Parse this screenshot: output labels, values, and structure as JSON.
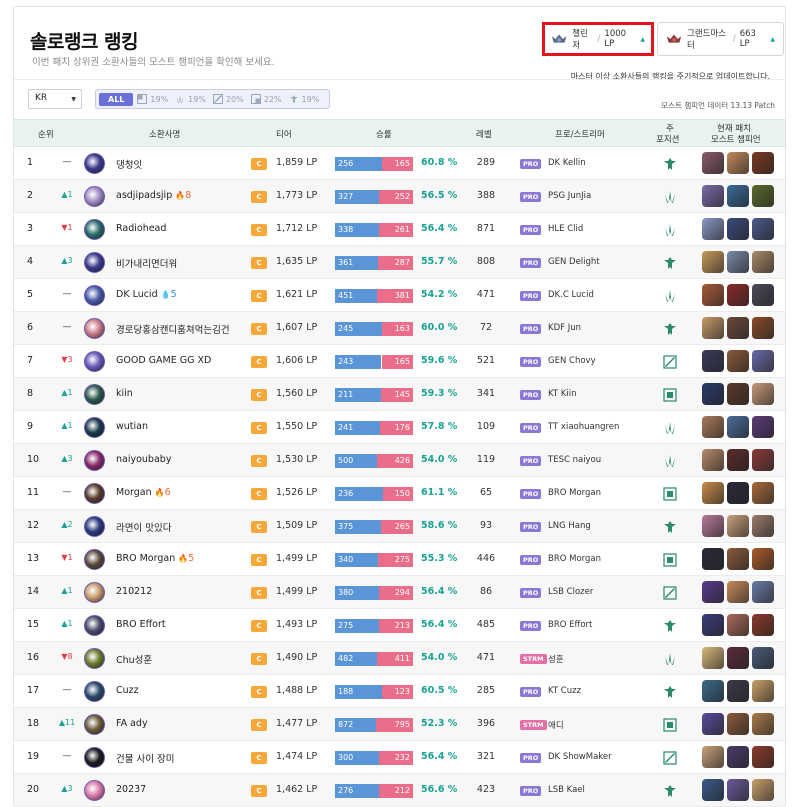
{
  "header": {
    "title": "솔로랭크 랭킹",
    "subtitle": "이번 패치 상위권 소환사들의 모스트 챔피언을 확인해 보세요.",
    "challenger": {
      "label": "챌린저",
      "lp": "1000 LP"
    },
    "grandmaster": {
      "label": "그랜드마스터",
      "lp": "663 LP"
    },
    "sep": "/",
    "update_note": "마스터 이상 소환사들의 랭킹을 주기적으로 업데이트합니다."
  },
  "filters": {
    "region": "KR",
    "all_label": "ALL",
    "positions": [
      {
        "icon": "top-lane-icon",
        "pct": "19%"
      },
      {
        "icon": "jungle-icon",
        "pct": "19%"
      },
      {
        "icon": "mid-lane-icon",
        "pct": "20%"
      },
      {
        "icon": "bot-lane-icon",
        "pct": "22%"
      },
      {
        "icon": "support-icon",
        "pct": "19%"
      }
    ],
    "patch_note": "모스트 챔피언 데이터 13.13 Patch"
  },
  "columns": {
    "rank": "순위",
    "name": "소환사명",
    "tier": "티어",
    "winrate": "승률",
    "level": "레벨",
    "pro": "프로/스트리머",
    "pos_line1": "주",
    "pos_line2": "포지션",
    "champ_line1": "현재 패치",
    "champ_line2": "모스트 챔피언"
  },
  "tier_letter": "C",
  "rows": [
    {
      "rank": "1",
      "change": "—",
      "dir": "same",
      "name": "댕청잇",
      "streak": "",
      "streak_type": "",
      "lp": "1,859 LP",
      "wins": "256",
      "losses": "165",
      "rate": "60.8 %",
      "level": "289",
      "badge": "PRO",
      "pro": "DK Kellin",
      "pos": "support",
      "avatar_color": "#3b3a8a",
      "champs": [
        "#8a5a6a",
        "#c48a5a",
        "#7a3a22"
      ]
    },
    {
      "rank": "2",
      "change": "▲1",
      "dir": "up",
      "name": "asdjipadsjip",
      "streak": "8",
      "streak_type": "fire",
      "lp": "1,773 LP",
      "wins": "327",
      "losses": "252",
      "rate": "56.5 %",
      "level": "388",
      "badge": "PRO",
      "pro": "PSG JunJia",
      "pos": "jungle",
      "avatar_color": "#a08ac4",
      "champs": [
        "#7a6aa8",
        "#3a6a9a",
        "#5a6a2a"
      ]
    },
    {
      "rank": "3",
      "change": "▼1",
      "dir": "down",
      "name": "Radiohead",
      "streak": "",
      "streak_type": "",
      "lp": "1,712 LP",
      "wins": "338",
      "losses": "261",
      "rate": "56.4 %",
      "level": "871",
      "badge": "PRO",
      "pro": "HLE Clid",
      "pos": "jungle",
      "avatar_color": "#2a6a6a",
      "champs": [
        "#8a9ac8",
        "#3a4a7a",
        "#4a5a8a"
      ]
    },
    {
      "rank": "4",
      "change": "▲3",
      "dir": "up",
      "name": "비가내리면더워",
      "streak": "",
      "streak_type": "",
      "lp": "1,635 LP",
      "wins": "361",
      "losses": "287",
      "rate": "55.7 %",
      "level": "808",
      "badge": "PRO",
      "pro": "GEN Delight",
      "pos": "support",
      "avatar_color": "#3a3a8a",
      "champs": [
        "#c89a5a",
        "#7a8aa8",
        "#aa8a6a"
      ]
    },
    {
      "rank": "5",
      "change": "—",
      "dir": "same",
      "name": "DK Lucid",
      "streak": "5",
      "streak_type": "water",
      "lp": "1,621 LP",
      "wins": "451",
      "losses": "381",
      "rate": "54.2 %",
      "level": "471",
      "badge": "PRO",
      "pro": "DK.C Lucid",
      "pos": "jungle",
      "avatar_color": "#4a5aa8",
      "champs": [
        "#aa5a3a",
        "#8a2a2a",
        "#4a4a5a"
      ]
    },
    {
      "rank": "6",
      "change": "—",
      "dir": "same",
      "name": "경로당홍삼캔디훔쳐먹는김건",
      "streak": "",
      "streak_type": "",
      "lp": "1,607 LP",
      "wins": "245",
      "losses": "163",
      "rate": "60.0 %",
      "level": "72",
      "badge": "PRO",
      "pro": "KDF Jun",
      "pos": "support",
      "avatar_color": "#c87a8a",
      "champs": [
        "#c89a6a",
        "#6a4a3a",
        "#8a4a2a"
      ]
    },
    {
      "rank": "7",
      "change": "▼3",
      "dir": "down",
      "name": "GOOD GAME GG XD",
      "streak": "",
      "streak_type": "",
      "lp": "1,606 LP",
      "wins": "243",
      "losses": "165",
      "rate": "59.6 %",
      "level": "521",
      "badge": "PRO",
      "pro": "GEN Chovy",
      "pos": "mid",
      "avatar_color": "#6a5ab8",
      "champs": [
        "#3a3a5a",
        "#8a5a3a",
        "#6a6aa8"
      ]
    },
    {
      "rank": "8",
      "change": "▲1",
      "dir": "up",
      "name": "kiin",
      "streak": "",
      "streak_type": "",
      "lp": "1,560 LP",
      "wins": "211",
      "losses": "145",
      "rate": "59.3 %",
      "level": "341",
      "badge": "PRO",
      "pro": "KT Kiin",
      "pos": "top",
      "avatar_color": "#2a5a4a",
      "champs": [
        "#2a3a6a",
        "#5a3a2a",
        "#c89a7a"
      ]
    },
    {
      "rank": "9",
      "change": "▲1",
      "dir": "up",
      "name": "wutian",
      "streak": "",
      "streak_type": "",
      "lp": "1,550 LP",
      "wins": "241",
      "losses": "176",
      "rate": "57.8 %",
      "level": "109",
      "badge": "PRO",
      "pro": "TT xiaohuangren",
      "pos": "jungle",
      "avatar_color": "#1a3a4a",
      "champs": [
        "#aa7a5a",
        "#4a6a9a",
        "#5a3a7a"
      ]
    },
    {
      "rank": "10",
      "change": "▲3",
      "dir": "up",
      "name": "naiyoubaby",
      "streak": "",
      "streak_type": "",
      "lp": "1,530 LP",
      "wins": "500",
      "losses": "426",
      "rate": "54.0 %",
      "level": "119",
      "badge": "PRO",
      "pro": "TESC naiyou",
      "pos": "jungle",
      "avatar_color": "#8a2a6a",
      "champs": [
        "#b88a6a",
        "#5a2a2a",
        "#8a3a3a"
      ]
    },
    {
      "rank": "11",
      "change": "—",
      "dir": "same",
      "name": "Morgan",
      "streak": "6",
      "streak_type": "fire",
      "lp": "1,526 LP",
      "wins": "236",
      "losses": "150",
      "rate": "61.1 %",
      "level": "65",
      "badge": "PRO",
      "pro": "BRO Morgan",
      "pos": "top",
      "avatar_color": "#5a3a2a",
      "champs": [
        "#c88a4a",
        "#2a2a3a",
        "#a86a3a"
      ]
    },
    {
      "rank": "12",
      "change": "▲2",
      "dir": "up",
      "name": "라면이 맛있다",
      "streak": "",
      "streak_type": "",
      "lp": "1,509 LP",
      "wins": "375",
      "losses": "265",
      "rate": "58.6 %",
      "level": "93",
      "badge": "PRO",
      "pro": "LNG Hang",
      "pos": "support",
      "avatar_color": "#2a3a7a",
      "champs": [
        "#b87a9a",
        "#c8a07a",
        "#9a7a6a"
      ]
    },
    {
      "rank": "13",
      "change": "▼1",
      "dir": "down",
      "name": "BRO Morgan",
      "streak": "5",
      "streak_type": "fire",
      "lp": "1,499 LP",
      "wins": "340",
      "losses": "275",
      "rate": "55.3 %",
      "level": "446",
      "badge": "PRO",
      "pro": "BRO Morgan",
      "pos": "top",
      "avatar_color": "#5a4a3a",
      "champs": [
        "#2a2a3a",
        "#8a5a3a",
        "#aa5a2a"
      ]
    },
    {
      "rank": "14",
      "change": "▲1",
      "dir": "up",
      "name": "210212",
      "streak": "",
      "streak_type": "",
      "lp": "1,499 LP",
      "wins": "380",
      "losses": "294",
      "rate": "56.4 %",
      "level": "86",
      "badge": "PRO",
      "pro": "LSB Clozer",
      "pos": "mid",
      "avatar_color": "#c89a6a",
      "champs": [
        "#5a3a8a",
        "#c88a5a",
        "#6a7aa8"
      ]
    },
    {
      "rank": "15",
      "change": "▲1",
      "dir": "up",
      "name": "BRO Effort",
      "streak": "",
      "streak_type": "",
      "lp": "1,493 LP",
      "wins": "275",
      "losses": "213",
      "rate": "56.4 %",
      "level": "485",
      "badge": "PRO",
      "pro": "BRO Effort",
      "pos": "support",
      "avatar_color": "#4a4a6a",
      "champs": [
        "#3a3a7a",
        "#aa6a5a",
        "#8a3a2a"
      ]
    },
    {
      "rank": "16",
      "change": "▼8",
      "dir": "down",
      "name": "Chu성훈",
      "streak": "",
      "streak_type": "",
      "lp": "1,490 LP",
      "wins": "482",
      "losses": "411",
      "rate": "54.0 %",
      "level": "471",
      "badge": "STRM",
      "pro": "성훈",
      "pos": "jungle",
      "avatar_color": "#6a7a2a",
      "champs": [
        "#d8b87a",
        "#5a2a3a",
        "#4a5a7a"
      ]
    },
    {
      "rank": "17",
      "change": "—",
      "dir": "same",
      "name": "Cuzz",
      "streak": "",
      "streak_type": "",
      "lp": "1,488 LP",
      "wins": "188",
      "losses": "123",
      "rate": "60.5 %",
      "level": "285",
      "badge": "PRO",
      "pro": "KT Cuzz",
      "pos": "support",
      "avatar_color": "#2a4a6a",
      "champs": [
        "#3a6a8a",
        "#3a3a4a",
        "#c8a06a"
      ]
    },
    {
      "rank": "18",
      "change": "▲11",
      "dir": "up",
      "name": "FA ady",
      "streak": "",
      "streak_type": "",
      "lp": "1,477 LP",
      "wins": "872",
      "losses": "795",
      "rate": "52.3 %",
      "level": "396",
      "badge": "STRM",
      "pro": "애디",
      "pos": "top",
      "avatar_color": "#6a5a3a",
      "champs": [
        "#5a4a9a",
        "#8a5a3a",
        "#aa7a4a"
      ]
    },
    {
      "rank": "19",
      "change": "—",
      "dir": "same",
      "name": "건물 사이 장미",
      "streak": "",
      "streak_type": "",
      "lp": "1,474 LP",
      "wins": "300",
      "losses": "232",
      "rate": "56.4 %",
      "level": "321",
      "badge": "PRO",
      "pro": "DK ShowMaker",
      "pos": "mid",
      "avatar_color": "#1a1a1a",
      "champs": [
        "#c8a07a",
        "#4a3a6a",
        "#8a3a2a"
      ]
    },
    {
      "rank": "20",
      "change": "▲3",
      "dir": "up",
      "name": "20237",
      "streak": "",
      "streak_type": "",
      "lp": "1,462 LP",
      "wins": "276",
      "losses": "212",
      "rate": "56.6 %",
      "level": "423",
      "badge": "PRO",
      "pro": "LSB Kael",
      "pos": "support",
      "avatar_color": "#d87aa8",
      "champs": [
        "#3a5a8a",
        "#6a5a9a",
        "#c8a06a"
      ]
    }
  ]
}
